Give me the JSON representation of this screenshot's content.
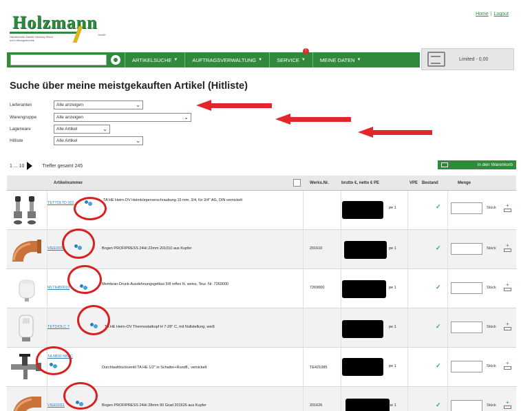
{
  "brand": {
    "logo_text": "Holzmann",
    "logo_tagline": "Haustechnik Sanitär Heizung Klima und Lüftungstechnik",
    "logo_small": "GmbH"
  },
  "top_links": {
    "home": "Home",
    "logout": "Logout"
  },
  "nav": {
    "items": [
      {
        "label": "ARTIKELSUCHE"
      },
      {
        "label": "AUFTRAGSVERWALTUNG"
      },
      {
        "label": "SERVICE"
      },
      {
        "label": "MEINE DATEN"
      }
    ],
    "service_badge": "!",
    "cart_text": "Limited - 0,00"
  },
  "page_title": "Suche über meine meistgekauften Artikel (Hitliste)",
  "filters": [
    {
      "label": "Lieferanten",
      "value": "Alle anzeigen"
    },
    {
      "label": "Warengruppe",
      "value": "Alle anzeigen"
    },
    {
      "label": "Lagerware",
      "value": "Alle Artikel"
    },
    {
      "label": "Hitliste",
      "value": "Alle Artikel"
    }
  ],
  "pager": {
    "range": "1 ... 10",
    "hits": "Treffer gesamt 245"
  },
  "add_to_cart_button": "in den Warenkorb",
  "table": {
    "headers": {
      "article_number": "Artikelnummer",
      "werks_nr": "Werks.Nr.",
      "price": "brutto €, netto € PE",
      "vpe": "VPE",
      "stock": "Bestand",
      "quantity": "Menge"
    },
    "rows": [
      {
        "art_nr": "TETTOLTD 001",
        "description": "TA HE Heim-OV Heimkörperverschraubung 15 mm, 3/4, für 3/4\" AG, DIN vernickelt",
        "werks_nr": "",
        "pe": "pe 1",
        "unit": "Stück"
      },
      {
        "art_nr": "VIEE0030",
        "description": "Bogen PROFIPRESS 24Hi 22mm 201010 aus Kupfer",
        "werks_nr": "201610",
        "pe": "pe 1",
        "unit": "Stück"
      },
      {
        "art_nr": "MLTIHB0019",
        "description": "Membran-Druck-Ausdehnungsgefäss 5/8 reflex N. weiss, Teur. Nr. 7269000",
        "werks_nr": "7269000",
        "pe": "pe 1",
        "unit": "Stück"
      },
      {
        "art_nr": "TETDIOLC 7",
        "description": "TA HE Heim-OV Thermostatkopf H 7-28° C, mit Nullstellung, weiß",
        "werks_nr": "",
        "pe": "pe 1",
        "unit": "Stück"
      },
      {
        "art_nr": "TA 6B00 NBLC",
        "description": "Durchlaufdruckventil TA HE 1/2\" in Schalter+Rundfl., vernickelt",
        "werks_nr": "TE421085",
        "pe": "pe 1",
        "unit": "Stück"
      },
      {
        "art_nr": "VIEE0031",
        "description": "Bogen PROFIPRESS 24Hi 28mm 90 Grad 201626 aus Kupfer",
        "werks_nr": "201626",
        "pe": "pe 1",
        "unit": "Stück"
      }
    ]
  },
  "colors": {
    "brand_green": "#2f8a3b",
    "annotation_red": "#e3262b",
    "link_blue": "#2a7fb8",
    "check_green": "#3aa24a"
  },
  "icons": [
    "search-icon",
    "cart-icon",
    "print-icon",
    "person-icon",
    "check-icon",
    "add-to-cart-icon"
  ]
}
